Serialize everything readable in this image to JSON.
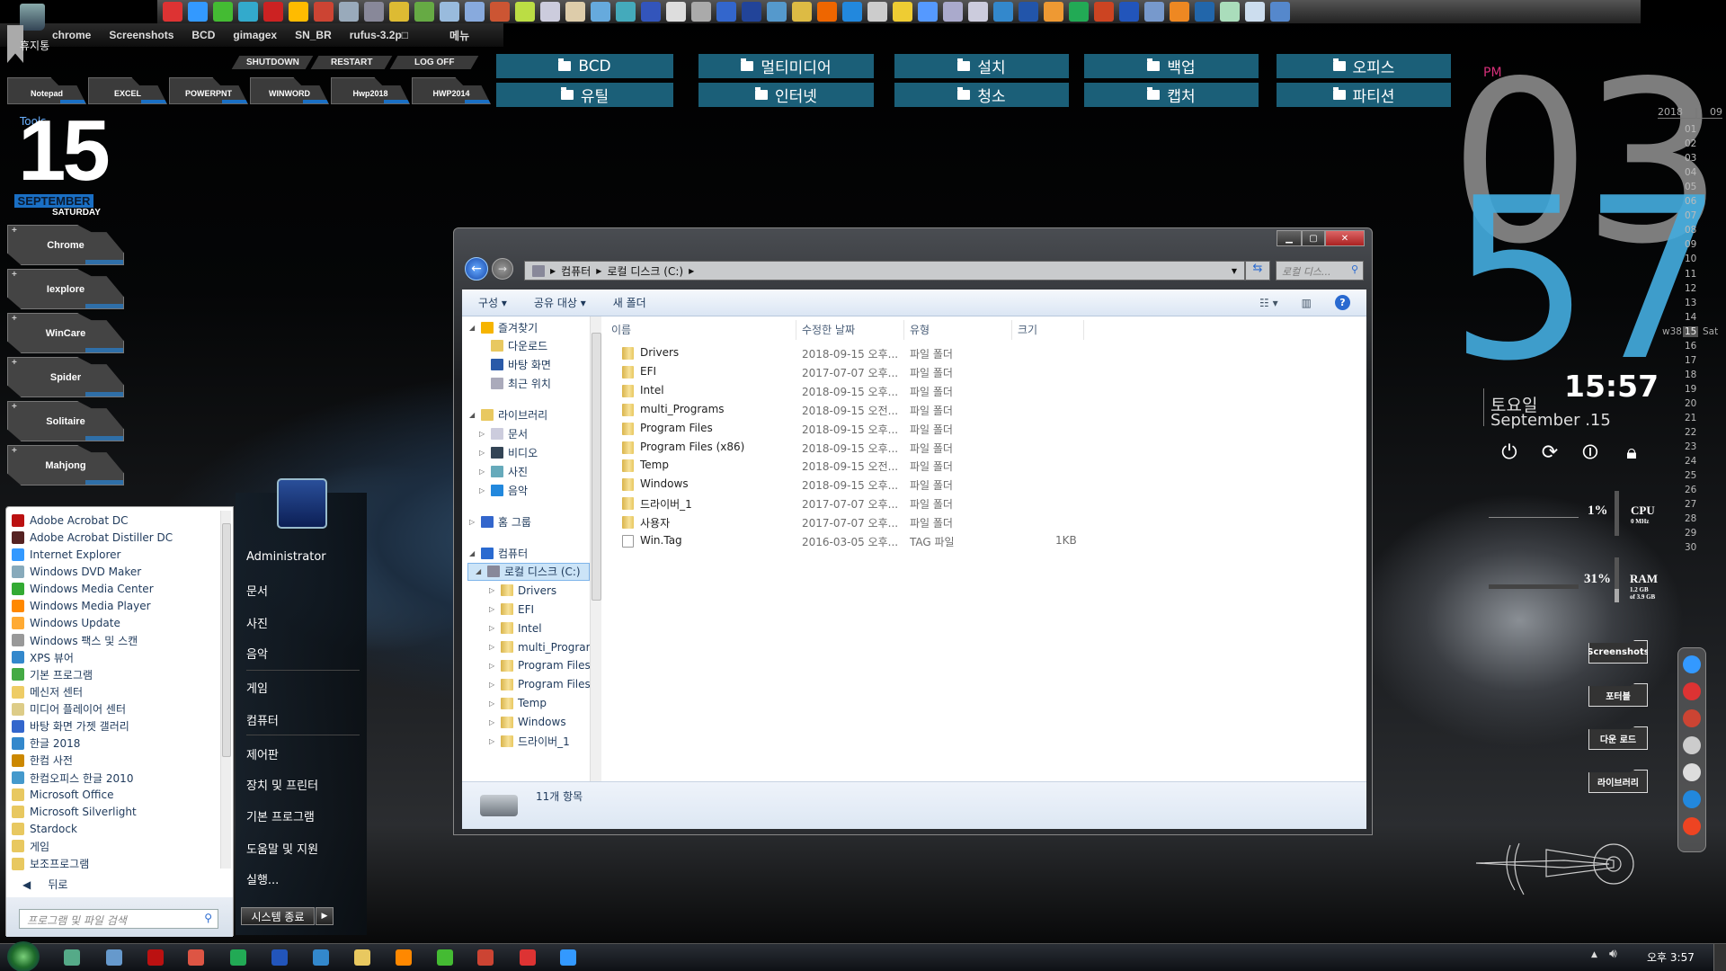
{
  "top_dock": {
    "icons": [
      "chrome-icon",
      "ie-icon",
      "clover-icon",
      "triangle-app-icon",
      "aida64-icon",
      "aimp-icon",
      "ccleaner-icon",
      "pc-icon",
      "drop-icon",
      "r-app-icon",
      "rubik-icon",
      "folder-app-icon",
      "note-icon",
      "color-app-icon",
      "edit-icon",
      "card-icon",
      "mahjong-icon",
      "window-icon",
      "globe-icon",
      "text-a-icon",
      "diamond-icon",
      "tools-icon",
      "circle-app-icon",
      "br-icon",
      "plug-icon",
      "gear-yellow-icon",
      "orange-circle-icon",
      "blue-circle-icon",
      "pen-icon",
      "grid-icon",
      "gauge-icon",
      "list-icon",
      "drive-icon",
      "b-app-icon",
      "f-app-icon",
      "play-icon",
      "excel-icon",
      "powerpoint-icon",
      "word-icon",
      "user-icon",
      "k-app-icon",
      "magnifier-icon",
      "monitor-icon",
      "notes-icon",
      "settings-icon"
    ],
    "colors": [
      "#d33",
      "#39f",
      "#4b3",
      "#3ac",
      "#c22",
      "#fb0",
      "#c43",
      "#9ab",
      "#889",
      "#db3",
      "#6a4",
      "#9bd",
      "#8ad",
      "#c53",
      "#bd4",
      "#ccd",
      "#dca",
      "#6ad",
      "#4ab",
      "#35b",
      "#ddd",
      "#aaa",
      "#36c",
      "#249",
      "#59c",
      "#db4",
      "#e60",
      "#28d",
      "#ccc",
      "#ec3",
      "#59f",
      "#aac",
      "#ccd",
      "#38c",
      "#25a",
      "#e93",
      "#2a5",
      "#c42",
      "#25b",
      "#79c",
      "#e82",
      "#26a",
      "#adb",
      "#cde",
      "#58c"
    ]
  },
  "shortcut_bar": {
    "items": [
      "chrome",
      "Screenshots",
      "BCD",
      "gimagex",
      "SN_BR",
      "rufus-3.2p□",
      "메뉴"
    ],
    "recycle_bin": "휴지통"
  },
  "power_buttons": [
    "SHUTDOWN",
    "RESTART",
    "LOG OFF"
  ],
  "app_tiles": [
    "Notepad",
    "EXCEL",
    "POWERPNT",
    "WINWORD",
    "Hwp2018",
    "HWP2014"
  ],
  "folder_tiles": {
    "row1": [
      "BCD",
      "멀티미디어",
      "설치",
      "백업",
      "오피스"
    ],
    "row2": [
      "유틸",
      "인터넷",
      "청소",
      "캡처",
      "파티션"
    ],
    "color": "#1b5f78"
  },
  "date_widget": {
    "tools_label": "Tools",
    "day": "15",
    "month": "SEPTEMBER",
    "weekday": "SATURDAY",
    "accent": "#1a6fc4"
  },
  "left_tiles": [
    "Chrome",
    "Iexplore",
    "WinCare",
    "Spider",
    "Solitaire",
    "Mahjong"
  ],
  "start_menu": {
    "programs": [
      {
        "label": "Adobe Acrobat DC",
        "icon": "acrobat-icon",
        "color": "#b11"
      },
      {
        "label": "Adobe Acrobat Distiller DC",
        "icon": "distiller-icon",
        "color": "#522"
      },
      {
        "label": "Internet Explorer",
        "icon": "ie-icon",
        "color": "#39f"
      },
      {
        "label": "Windows DVD Maker",
        "icon": "dvd-icon",
        "color": "#8ab"
      },
      {
        "label": "Windows Media Center",
        "icon": "media-center-icon",
        "color": "#3a3"
      },
      {
        "label": "Windows Media Player",
        "icon": "media-player-icon",
        "color": "#f80"
      },
      {
        "label": "Windows Update",
        "icon": "windows-update-icon",
        "color": "#fa3"
      },
      {
        "label": "Windows 팩스 및 스캔",
        "icon": "fax-icon",
        "color": "#999"
      },
      {
        "label": "XPS 뷰어",
        "icon": "xps-icon",
        "color": "#38c"
      },
      {
        "label": "기본 프로그램",
        "icon": "default-programs-icon",
        "color": "#4a4"
      },
      {
        "label": "메신저 센터",
        "icon": "messenger-icon",
        "color": "#ec6"
      },
      {
        "label": "미디어 플레이어 센터",
        "icon": "media-player-center-icon",
        "color": "#dc8"
      },
      {
        "label": "바탕 화면 가젯 갤러리",
        "icon": "gadget-icon",
        "color": "#36c"
      },
      {
        "label": "한글 2018",
        "icon": "hangul-icon",
        "color": "#38c"
      },
      {
        "label": "한컴 사전",
        "icon": "dictionary-icon",
        "color": "#c80"
      },
      {
        "label": "한컴오피스 한글 2010",
        "icon": "pen-icon",
        "color": "#49c"
      },
      {
        "label": "Microsoft Office",
        "icon": "folder-icon",
        "color": "#e8c860"
      },
      {
        "label": "Microsoft Silverlight",
        "icon": "folder-icon",
        "color": "#e8c860"
      },
      {
        "label": "Stardock",
        "icon": "folder-icon",
        "color": "#e8c860"
      },
      {
        "label": "게임",
        "icon": "folder-icon",
        "color": "#e8c860"
      },
      {
        "label": "보조프로그램",
        "icon": "folder-icon",
        "color": "#e8c860"
      }
    ],
    "back": "뒤로",
    "search_placeholder": "프로그램 및 파일 검색",
    "right": [
      "Administrator",
      "문서",
      "사진",
      "음악",
      "게임",
      "컴퓨터",
      "제어판",
      "장치 및 프린터",
      "기본 프로그램",
      "도움말 및 지원",
      "실행..."
    ],
    "shutdown": "시스템 종료"
  },
  "explorer": {
    "path": [
      "컴퓨터",
      "로컬 디스크 (C:)"
    ],
    "search_placeholder": "로컬 디스...",
    "toolbar": [
      "구성 ▾",
      "공유 대상 ▾",
      "새 폴더"
    ],
    "nav": [
      {
        "label": "즐겨찾기",
        "level": 0,
        "tri": "◢",
        "icon": "star-icon",
        "color": "#f6b400"
      },
      {
        "label": "다운로드",
        "level": 1,
        "icon": "downloads-icon",
        "color": "#e8c860"
      },
      {
        "label": "바탕 화면",
        "level": 1,
        "icon": "desktop-icon",
        "color": "#2a5aa8"
      },
      {
        "label": "최근 위치",
        "level": 1,
        "icon": "recent-places-icon",
        "color": "#aab"
      },
      {
        "gap": true
      },
      {
        "label": "라이브러리",
        "level": 0,
        "tri": "◢",
        "icon": "library-icon",
        "color": "#e8c860"
      },
      {
        "label": "문서",
        "level": 1,
        "tri": "▷",
        "icon": "documents-icon",
        "color": "#ccd"
      },
      {
        "label": "비디오",
        "level": 1,
        "tri": "▷",
        "icon": "video-icon",
        "color": "#345"
      },
      {
        "label": "사진",
        "level": 1,
        "tri": "▷",
        "icon": "pictures-icon",
        "color": "#6ab"
      },
      {
        "label": "음악",
        "level": 1,
        "tri": "▷",
        "icon": "music-icon",
        "color": "#28d"
      },
      {
        "gap": true
      },
      {
        "label": "홈 그룹",
        "level": 0,
        "tri": "▷",
        "icon": "homegroup-icon",
        "color": "#36c"
      },
      {
        "gap": true
      },
      {
        "label": "컴퓨터",
        "level": 0,
        "tri": "◢",
        "icon": "computer-icon",
        "color": "#2a6ad0"
      },
      {
        "label": "로컬 디스크 (C:)",
        "level": 1,
        "tri": "◢",
        "icon": "drive-icon",
        "color": "#889",
        "selected": true
      },
      {
        "label": "Drivers",
        "level": 2,
        "tri": "▷",
        "icon": "folder-icon"
      },
      {
        "label": "EFI",
        "level": 2,
        "tri": "▷",
        "icon": "folder-icon"
      },
      {
        "label": "Intel",
        "level": 2,
        "tri": "▷",
        "icon": "folder-icon"
      },
      {
        "label": "multi_Program",
        "level": 2,
        "tri": "▷",
        "icon": "folder-icon"
      },
      {
        "label": "Program Files",
        "level": 2,
        "tri": "▷",
        "icon": "folder-icon"
      },
      {
        "label": "Program Files (",
        "level": 2,
        "tri": "▷",
        "icon": "folder-icon"
      },
      {
        "label": "Temp",
        "level": 2,
        "tri": "▷",
        "icon": "folder-icon"
      },
      {
        "label": "Windows",
        "level": 2,
        "tri": "▷",
        "icon": "folder-icon"
      },
      {
        "label": "드라이버_1",
        "level": 2,
        "tri": "▷",
        "icon": "folder-icon"
      }
    ],
    "columns": [
      "이름",
      "수정한 날짜",
      "유형",
      "크기"
    ],
    "files": [
      {
        "name": "Drivers",
        "date": "2018-09-15 오후...",
        "type": "파일 폴더",
        "size": "",
        "kind": "folder"
      },
      {
        "name": "EFI",
        "date": "2017-07-07 오후...",
        "type": "파일 폴더",
        "size": "",
        "kind": "folder"
      },
      {
        "name": "Intel",
        "date": "2018-09-15 오후...",
        "type": "파일 폴더",
        "size": "",
        "kind": "folder"
      },
      {
        "name": "multi_Programs",
        "date": "2018-09-15 오전...",
        "type": "파일 폴더",
        "size": "",
        "kind": "folder"
      },
      {
        "name": "Program Files",
        "date": "2018-09-15 오후...",
        "type": "파일 폴더",
        "size": "",
        "kind": "folder"
      },
      {
        "name": "Program Files (x86)",
        "date": "2018-09-15 오후...",
        "type": "파일 폴더",
        "size": "",
        "kind": "folder"
      },
      {
        "name": "Temp",
        "date": "2018-09-15 오전...",
        "type": "파일 폴더",
        "size": "",
        "kind": "folder"
      },
      {
        "name": "Windows",
        "date": "2018-09-15 오후...",
        "type": "파일 폴더",
        "size": "",
        "kind": "folder"
      },
      {
        "name": "드라이버_1",
        "date": "2017-07-07 오후...",
        "type": "파일 폴더",
        "size": "",
        "kind": "folder"
      },
      {
        "name": "사용자",
        "date": "2017-07-07 오후...",
        "type": "파일 폴더",
        "size": "",
        "kind": "folder"
      },
      {
        "name": "Win.Tag",
        "date": "2016-03-05 오후...",
        "type": "TAG 파일",
        "size": "1KB",
        "kind": "file"
      }
    ],
    "status": "11개 항목"
  },
  "clock": {
    "ampm": "PM",
    "hour": "03",
    "minute": "57",
    "digital": "15:57",
    "korean_day": "토요일",
    "date_text": "September .15",
    "ampm_color": "#d6307a",
    "minute_color": "#43aadc"
  },
  "calendar": {
    "year": "2018",
    "month": "09",
    "week": "w38",
    "today": "15",
    "today_dow": "Sat",
    "days": [
      "01",
      "02",
      "03",
      "04",
      "05",
      "06",
      "07",
      "08",
      "09",
      "10",
      "11",
      "12",
      "13",
      "14",
      "15",
      "16",
      "17",
      "18",
      "19",
      "20",
      "21",
      "22",
      "23",
      "24",
      "25",
      "26",
      "27",
      "28",
      "29",
      "30"
    ]
  },
  "system_meters": {
    "cpu_percent": "1%",
    "cpu_label": "CPU",
    "cpu_sub": "0 MHz",
    "ram_percent": "31%",
    "ram_label": "RAM",
    "ram_sub1": "1.2 GB",
    "ram_sub2": "of 3.9 GB"
  },
  "right_folders": [
    "Screenshots",
    "포터블",
    "다운 로드",
    "라이브러리"
  ],
  "right_dock": [
    {
      "icon": "ie-icon",
      "color": "#39f"
    },
    {
      "icon": "chrome-icon",
      "color": "#d33"
    },
    {
      "icon": "ccleaner-icon",
      "color": "#c43"
    },
    {
      "icon": "add-monitor-icon",
      "color": "#ccc"
    },
    {
      "icon": "eraser-icon",
      "color": "#ddd"
    },
    {
      "icon": "logoff-icon",
      "color": "#28d"
    },
    {
      "icon": "power-icon",
      "color": "#e42"
    }
  ],
  "taskbar": {
    "icons": [
      {
        "icon": "grid-icon",
        "color": "#5a8"
      },
      {
        "icon": "pen-icon",
        "color": "#69c"
      },
      {
        "icon": "acrobat-icon",
        "color": "#b11"
      },
      {
        "icon": "powerpoint-icon",
        "color": "#d54"
      },
      {
        "icon": "excel-icon",
        "color": "#2a5"
      },
      {
        "icon": "word-icon",
        "color": "#25b"
      },
      {
        "icon": "hangul-icon",
        "color": "#38c"
      },
      {
        "icon": "explorer-icon",
        "color": "#e8c860"
      },
      {
        "icon": "media-player-icon",
        "color": "#f80"
      },
      {
        "icon": "clover-icon",
        "color": "#4b3"
      },
      {
        "icon": "ccleaner-icon",
        "color": "#c43"
      },
      {
        "icon": "chrome-icon",
        "color": "#d33"
      },
      {
        "icon": "ie-icon",
        "color": "#39f"
      }
    ],
    "time": "오후 3:57"
  }
}
